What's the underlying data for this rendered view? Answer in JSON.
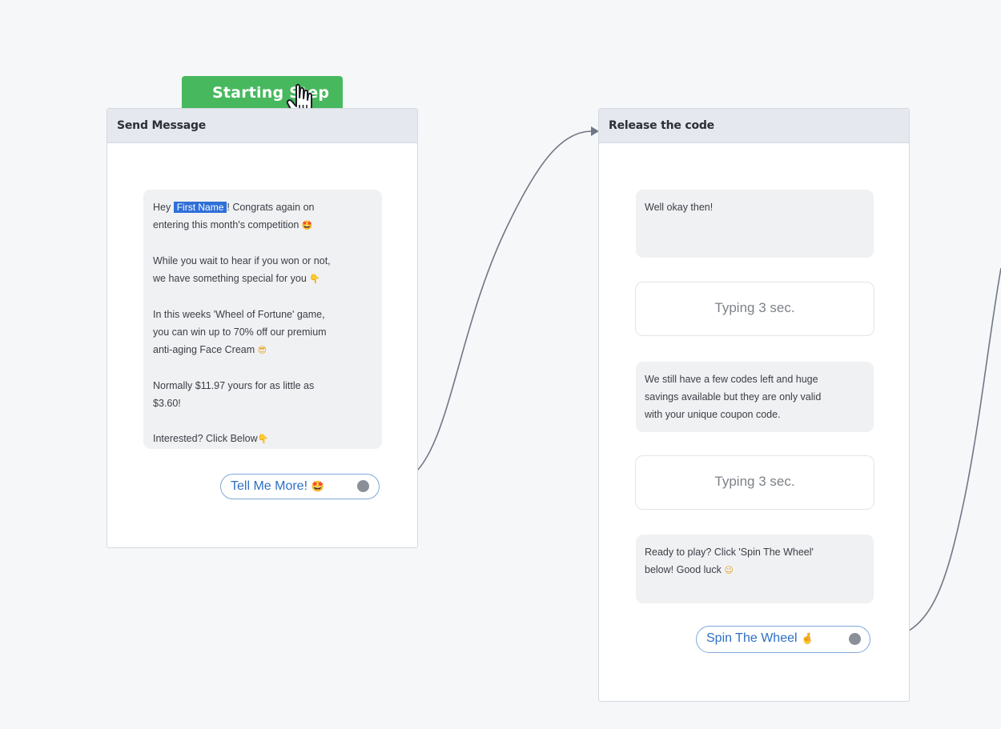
{
  "start_badge": {
    "label": "Starting Step"
  },
  "nodes": {
    "send": {
      "title": "Send Message",
      "message": {
        "hey": "Hey ",
        "first_name_tag": "First Name",
        "line1_rest": "! Congrats again on",
        "line2": "entering this month's competition",
        "line2_emoji": "🤩",
        "para2_line1": "While you wait to hear if you won or not,",
        "para2_line2": "we have something special for you",
        "para2_emoji": "👇",
        "para3_line1": "In this weeks 'Wheel of Fortune' game,",
        "para3_line2": "you can win up to 70% off our premium",
        "para3_line3": "anti-aging Face Cream",
        "para3_emoji": "😎",
        "para4_line1": "Normally $11.97 yours for as little as",
        "para4_line2": "$3.60!",
        "para5": "Interested? Click Below",
        "para5_emoji": "👇"
      },
      "button": {
        "label": "Tell Me More!",
        "emoji": "🤩"
      }
    },
    "release": {
      "title": "Release the code",
      "bubble1": "Well okay then!",
      "typing1": "Typing 3 sec.",
      "bubble2_line1": "We still have a few codes left and huge",
      "bubble2_line2": "savings available but they are only valid",
      "bubble2_line3": "with your unique coupon code.",
      "typing2": "Typing 3 sec.",
      "bubble3_line1": "Ready to play? Click 'Spin The Wheel'",
      "bubble3_line2": "below! Good luck",
      "bubble3_emoji": "😉",
      "button": {
        "label": "Spin The Wheel",
        "emoji": "🤞"
      }
    }
  },
  "colors": {
    "canvas": "#f6f7f9",
    "start_badge": "#48b85e",
    "header": "#e5e8ee",
    "first_name_tag": "#2f6fd8",
    "button_text": "#2d6fc4",
    "connector": "#707784"
  }
}
